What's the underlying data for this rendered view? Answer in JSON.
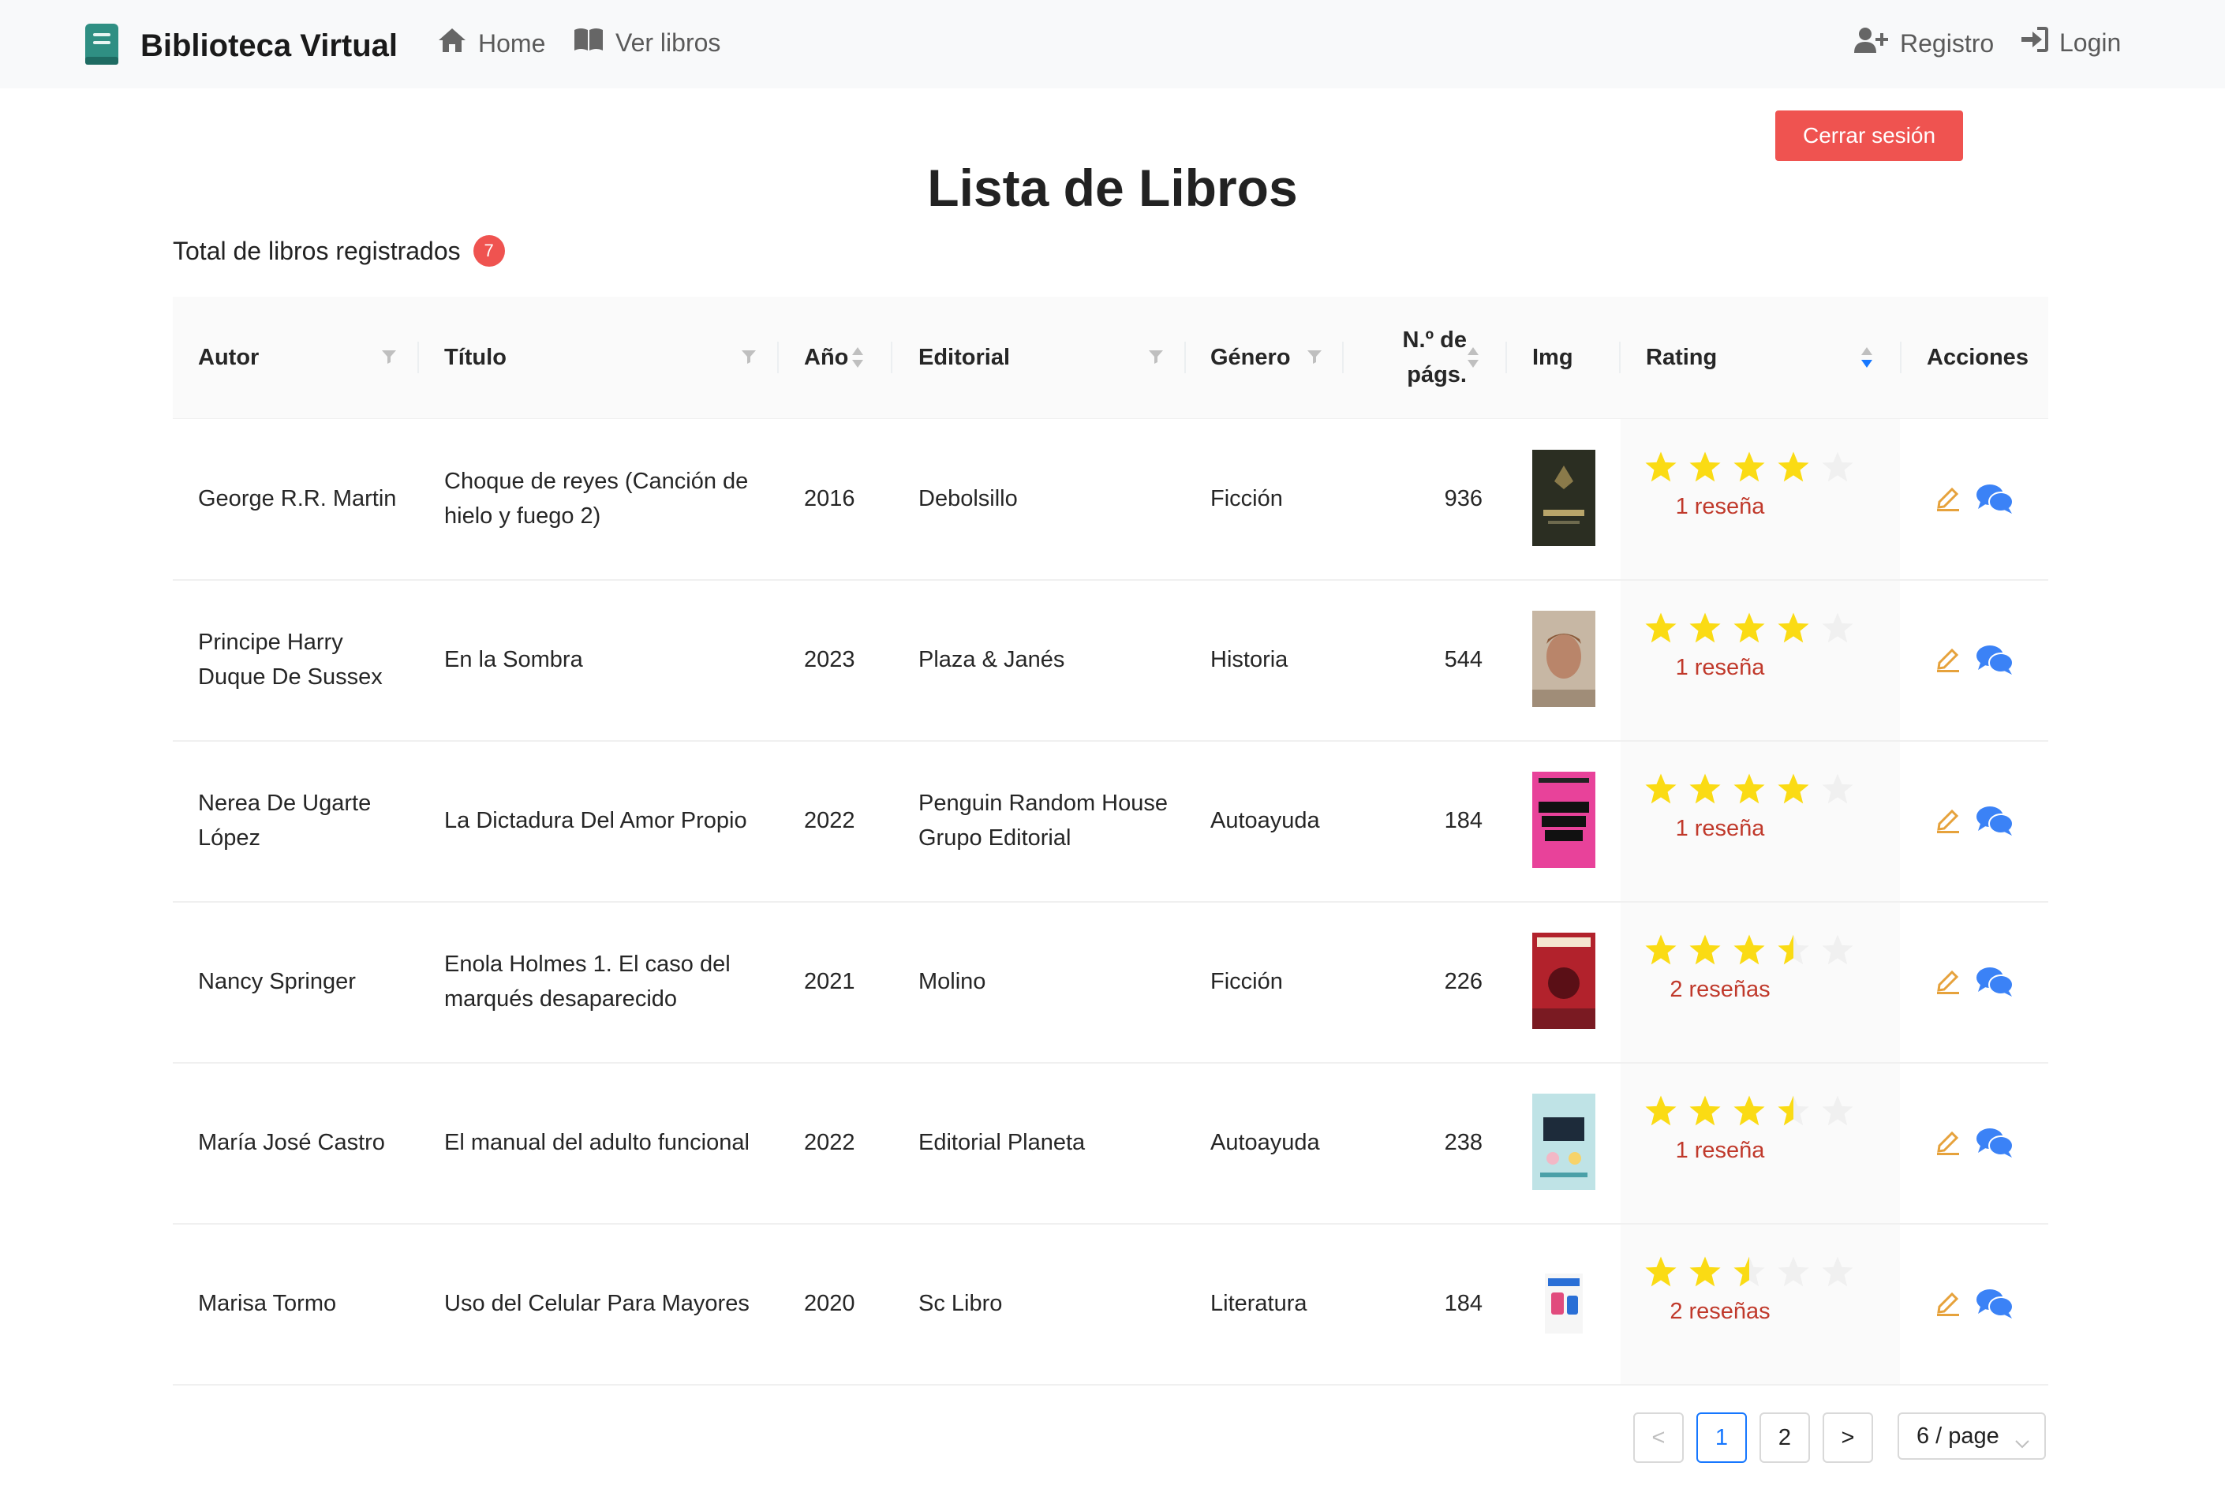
{
  "nav": {
    "brand": "Biblioteca Virtual",
    "home": "Home",
    "books": "Ver libros",
    "register": "Registro",
    "login": "Login"
  },
  "logout_label": "Cerrar sesión",
  "page_title": "Lista de Libros",
  "total": {
    "label": "Total de libros registrados",
    "count": "7"
  },
  "columns": {
    "author": "Autor",
    "title": "Título",
    "year": "Año",
    "publisher": "Editorial",
    "genre": "Género",
    "pages_line1": "N.º de",
    "pages_line2": "págs.",
    "img": "Img",
    "rating": "Rating",
    "actions": "Acciones"
  },
  "books": [
    {
      "author": "George R.R. Martin",
      "title": "Choque de reyes (Canción de hielo y fuego 2)",
      "year": "2016",
      "publisher": "Debolsillo",
      "genre": "Ficción",
      "pages": "936",
      "rating": 4,
      "reviews": "1 reseña"
    },
    {
      "author": "Principe Harry Duque De Sussex",
      "title": "En la Sombra",
      "year": "2023",
      "publisher": "Plaza & Janés",
      "genre": "Historia",
      "pages": "544",
      "rating": 4,
      "reviews": "1 reseña"
    },
    {
      "author": "Nerea De Ugarte López",
      "title": "La Dictadura Del Amor Propio",
      "year": "2022",
      "publisher": "Penguin Random House Grupo Editorial",
      "genre": "Autoayuda",
      "pages": "184",
      "rating": 4,
      "reviews": "1 reseña"
    },
    {
      "author": "Nancy Springer",
      "title": "Enola Holmes 1. El caso del marqués desaparecido",
      "year": "2021",
      "publisher": "Molino",
      "genre": "Ficción",
      "pages": "226",
      "rating": 3.5,
      "reviews": "2 reseñas"
    },
    {
      "author": "María José Castro",
      "title": "El manual del adulto funcional",
      "year": "2022",
      "publisher": "Editorial Planeta",
      "genre": "Autoayuda",
      "pages": "238",
      "rating": 3.5,
      "reviews": "1 reseña"
    },
    {
      "author": "Marisa Tormo",
      "title": "Uso del Celular Para Mayores",
      "year": "2020",
      "publisher": "Sc Libro",
      "genre": "Literatura",
      "pages": "184",
      "rating": 2.5,
      "reviews": "2 reseñas"
    }
  ],
  "pagination": {
    "prev": "<",
    "pages": [
      "1",
      "2"
    ],
    "current": "1",
    "next": ">",
    "page_size": "6 / page"
  },
  "colors": {
    "accent_red": "#ef5350",
    "star": "#fadb14",
    "star_empty": "#f0f0f0",
    "edit": "#e6a23c",
    "chat": "#3b82f6",
    "brand_icon": "#2f8f83"
  }
}
